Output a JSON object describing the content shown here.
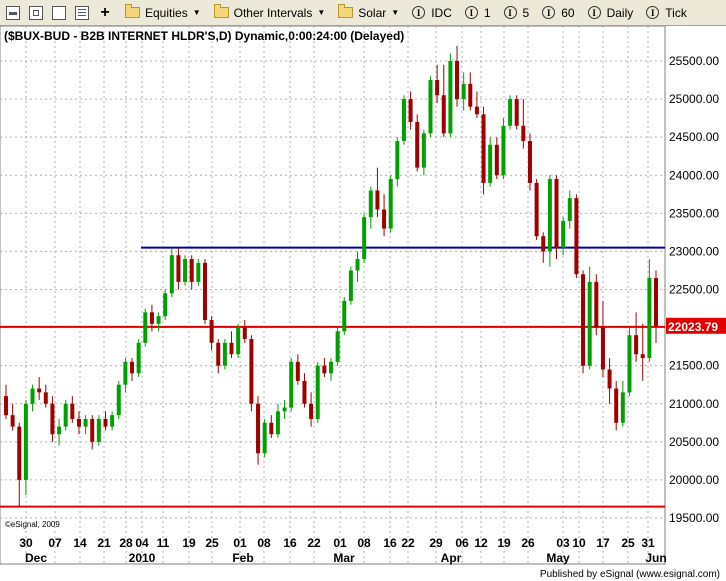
{
  "toolbar": {
    "equities_label": "Equities",
    "intervals_label": "Other Intervals",
    "solar_label": "Solar",
    "idc_label": "IDC",
    "interval_1": "1",
    "interval_5": "5",
    "interval_60": "60",
    "daily_label": "Daily",
    "tick_label": "Tick",
    "icon_letter": "I"
  },
  "chart_title": "($BUX-BUD - B2B INTERNET HLDR'S,D) Dynamic,0:00:24:00 (Delayed)",
  "copyright": "©eSignal, 2009",
  "published_by": "Published by eSignal (www.esignal.com)",
  "price_label": "22023.79",
  "colors": {
    "up": "#00a000",
    "down": "#a00000",
    "resistance": "#0000a0",
    "support": "#e00000",
    "label_bg": "#e00000"
  },
  "chart_data": {
    "type": "candlestick",
    "ylim": [
      19500,
      25700
    ],
    "yticks": [
      "25500.00",
      "25000.00",
      "24500.00",
      "24000.00",
      "23500.00",
      "23000.00",
      "22500.00",
      "22000.00",
      "21500.00",
      "21000.00",
      "20500.00",
      "20000.00",
      "19500.00"
    ],
    "x_day_labels": [
      "30",
      "07",
      "14",
      "21",
      "28",
      "04",
      "11",
      "19",
      "25",
      "01",
      "08",
      "16",
      "22",
      "01",
      "08",
      "16",
      "22",
      "29",
      "06",
      "12",
      "19",
      "26",
      "03",
      "10",
      "17",
      "25",
      "31"
    ],
    "x_month_labels": [
      "Dec",
      "2010",
      "Feb",
      "Mar",
      "Apr",
      "May",
      "Jun"
    ],
    "hlines": [
      {
        "value": 23050,
        "color": "resistance"
      },
      {
        "value": 22010,
        "color": "support"
      },
      {
        "value": 19650,
        "color": "support"
      }
    ],
    "last_price": 22023.79,
    "ohlc": [
      [
        21100,
        21250,
        20800,
        20850
      ],
      [
        20850,
        21000,
        20650,
        20700
      ],
      [
        20700,
        20750,
        19650,
        20000
      ],
      [
        20000,
        21050,
        19800,
        21000
      ],
      [
        21000,
        21250,
        20900,
        21200
      ],
      [
        21200,
        21350,
        21050,
        21150
      ],
      [
        21150,
        21250,
        20950,
        21000
      ],
      [
        21000,
        21100,
        20500,
        20600
      ],
      [
        20600,
        20800,
        20450,
        20700
      ],
      [
        20700,
        21050,
        20650,
        21000
      ],
      [
        21000,
        21100,
        20750,
        20800
      ],
      [
        20800,
        20900,
        20600,
        20700
      ],
      [
        20700,
        20850,
        20600,
        20800
      ],
      [
        20800,
        20850,
        20400,
        20500
      ],
      [
        20500,
        20850,
        20450,
        20800
      ],
      [
        20800,
        20900,
        20650,
        20700
      ],
      [
        20700,
        20900,
        20650,
        20850
      ],
      [
        20850,
        21300,
        20800,
        21250
      ],
      [
        21250,
        21600,
        21150,
        21550
      ],
      [
        21550,
        21600,
        21300,
        21400
      ],
      [
        21400,
        21850,
        21350,
        21800
      ],
      [
        21800,
        22250,
        21750,
        22200
      ],
      [
        22200,
        22300,
        21950,
        22050
      ],
      [
        22050,
        22200,
        21950,
        22150
      ],
      [
        22150,
        22500,
        22100,
        22450
      ],
      [
        22450,
        23050,
        22400,
        22950
      ],
      [
        22950,
        23050,
        22500,
        22600
      ],
      [
        22600,
        22950,
        22550,
        22900
      ],
      [
        22900,
        22950,
        22500,
        22600
      ],
      [
        22600,
        22900,
        22550,
        22850
      ],
      [
        22850,
        22900,
        22050,
        22100
      ],
      [
        22100,
        22150,
        21700,
        21800
      ],
      [
        21800,
        21850,
        21400,
        21500
      ],
      [
        21500,
        21850,
        21450,
        21800
      ],
      [
        21800,
        21950,
        21600,
        21650
      ],
      [
        21650,
        22050,
        21600,
        22000
      ],
      [
        22000,
        22100,
        21800,
        21850
      ],
      [
        21850,
        21900,
        20900,
        21000
      ],
      [
        21000,
        21100,
        20200,
        20350
      ],
      [
        20350,
        20800,
        20300,
        20750
      ],
      [
        20750,
        20850,
        20550,
        20600
      ],
      [
        20600,
        21000,
        20550,
        20900
      ],
      [
        20900,
        21050,
        20800,
        20950
      ],
      [
        20950,
        21600,
        20900,
        21550
      ],
      [
        21550,
        21650,
        21250,
        21300
      ],
      [
        21300,
        21400,
        20950,
        21000
      ],
      [
        21000,
        21150,
        20700,
        20800
      ],
      [
        20800,
        21550,
        20750,
        21500
      ],
      [
        21500,
        21600,
        21350,
        21400
      ],
      [
        21400,
        21600,
        21300,
        21550
      ],
      [
        21550,
        22000,
        21500,
        21950
      ],
      [
        21950,
        22400,
        21900,
        22350
      ],
      [
        22350,
        22800,
        22300,
        22750
      ],
      [
        22750,
        23000,
        22600,
        22900
      ],
      [
        22900,
        23500,
        22850,
        23450
      ],
      [
        23450,
        23850,
        23300,
        23800
      ],
      [
        23800,
        24100,
        23450,
        23550
      ],
      [
        23550,
        23750,
        23200,
        23300
      ],
      [
        23300,
        24000,
        23250,
        23950
      ],
      [
        23950,
        24500,
        23850,
        24450
      ],
      [
        24450,
        25050,
        24400,
        25000
      ],
      [
        25000,
        25100,
        24600,
        24700
      ],
      [
        24700,
        24800,
        24050,
        24100
      ],
      [
        24100,
        24600,
        24000,
        24550
      ],
      [
        24550,
        25300,
        24500,
        25250
      ],
      [
        25250,
        25450,
        24950,
        25050
      ],
      [
        25050,
        25450,
        24500,
        24550
      ],
      [
        24550,
        25600,
        24500,
        25500
      ],
      [
        25500,
        25700,
        24900,
        25000
      ],
      [
        25000,
        25350,
        24850,
        25200
      ],
      [
        25200,
        25350,
        24850,
        24900
      ],
      [
        24900,
        25100,
        24750,
        24800
      ],
      [
        24800,
        24900,
        23750,
        23900
      ],
      [
        23900,
        24500,
        23850,
        24400
      ],
      [
        24400,
        24500,
        23950,
        24000
      ],
      [
        24000,
        24750,
        23950,
        24650
      ],
      [
        24650,
        25050,
        24600,
        25000
      ],
      [
        25000,
        25050,
        24600,
        24650
      ],
      [
        24650,
        25000,
        24350,
        24450
      ],
      [
        24450,
        24550,
        23800,
        23900
      ],
      [
        23900,
        23950,
        23150,
        23200
      ],
      [
        23200,
        23250,
        22850,
        23000
      ],
      [
        23000,
        24000,
        22800,
        23950
      ],
      [
        23950,
        24000,
        22900,
        23050
      ],
      [
        23050,
        23450,
        22950,
        23400
      ],
      [
        23400,
        23800,
        23300,
        23700
      ],
      [
        23700,
        23750,
        22650,
        22700
      ],
      [
        22700,
        22750,
        21400,
        21500
      ],
      [
        21500,
        22800,
        21450,
        22600
      ],
      [
        22600,
        22700,
        21900,
        22000
      ],
      [
        22000,
        22350,
        21350,
        21450
      ],
      [
        21450,
        21600,
        21000,
        21200
      ],
      [
        21200,
        21300,
        20650,
        20750
      ],
      [
        20750,
        21300,
        20700,
        21150
      ],
      [
        21150,
        22000,
        21100,
        21900
      ],
      [
        21900,
        22200,
        21550,
        21650
      ],
      [
        21650,
        22050,
        21300,
        21600
      ],
      [
        21600,
        22900,
        21550,
        22650
      ],
      [
        22650,
        22750,
        21800,
        22020
      ]
    ]
  }
}
